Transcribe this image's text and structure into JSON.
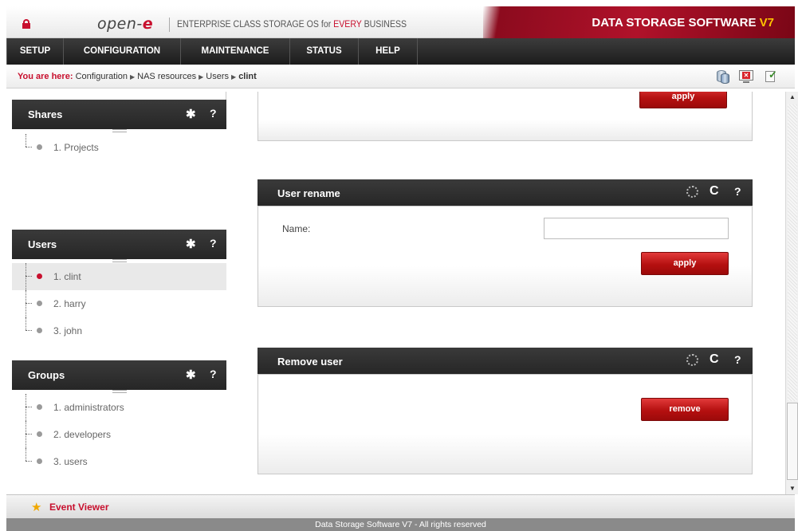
{
  "header": {
    "logo_text": "open-",
    "logo_accent": "e",
    "tagline_prefix": "ENTERPRISE CLASS STORAGE OS for ",
    "tagline_accent": "EVERY",
    "tagline_suffix": " BUSINESS",
    "brand_text": "DATA STORAGE SOFTWARE ",
    "brand_version": "V7",
    "brand_color": "#b0122a",
    "version_color": "#ffc400"
  },
  "menu": {
    "items": [
      {
        "label": "SETUP"
      },
      {
        "label": "CONFIGURATION"
      },
      {
        "label": "MAINTENANCE"
      },
      {
        "label": "STATUS"
      },
      {
        "label": "HELP"
      }
    ]
  },
  "breadcrumb": {
    "label": "You are here:",
    "items": [
      "Configuration",
      "NAS resources",
      "Users"
    ],
    "current": "clint",
    "arrow": "▶"
  },
  "toolbar": {
    "icons": [
      "database-icon",
      "logout-icon",
      "status-check-icon"
    ]
  },
  "sidebar": {
    "shares": {
      "title": "Shares",
      "items": [
        {
          "label": "1. Projects"
        }
      ]
    },
    "users": {
      "title": "Users",
      "items": [
        {
          "label": "1. clint",
          "selected": true
        },
        {
          "label": "2. harry"
        },
        {
          "label": "3. john"
        }
      ]
    },
    "groups": {
      "title": "Groups",
      "items": [
        {
          "label": "1. administrators"
        },
        {
          "label": "2. developers"
        },
        {
          "label": "3. users"
        }
      ]
    },
    "icons": {
      "gear": "✱",
      "help": "?"
    }
  },
  "main": {
    "top_box": {
      "apply_label": "apply"
    },
    "user_rename": {
      "title": "User rename",
      "name_label": "Name:",
      "name_value": "",
      "apply_label": "apply"
    },
    "remove_user": {
      "title": "Remove user",
      "remove_label": "remove"
    },
    "icons": {
      "refresh": "C",
      "help": "?"
    }
  },
  "events": {
    "label": "Event Viewer"
  },
  "footer": {
    "text": "Data Storage Software V7 - All rights reserved"
  }
}
